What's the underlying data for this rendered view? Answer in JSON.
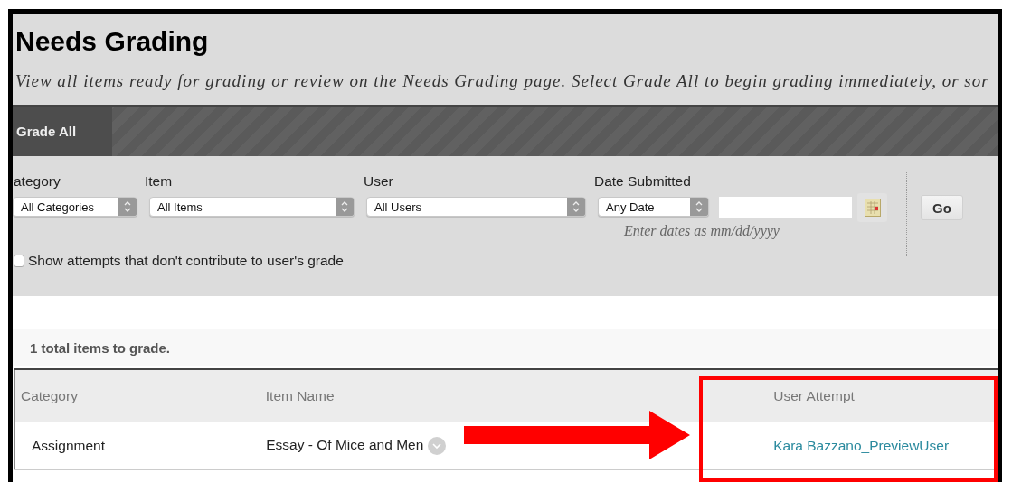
{
  "page": {
    "title": "Needs Grading",
    "description": "View all items ready for grading or review on the Needs Grading page. Select Grade All to begin grading immediately, or sor"
  },
  "action_bar": {
    "buttons": [
      "Grade All"
    ]
  },
  "filters": [
    {
      "label": "ategory",
      "value": "All Categories"
    },
    {
      "label": "Item",
      "value": "All Items"
    },
    {
      "label": "User",
      "value": "All Users"
    },
    {
      "label": "Date Submitted",
      "value": "Any Date"
    }
  ],
  "date_hint": "Enter dates as mm/dd/yyyy",
  "go_button": "Go",
  "show_attempts": {
    "label": "Show attempts that don't contribute to user's grade",
    "checked": false
  },
  "summary": "1 total items to grade.",
  "table": {
    "columns": [
      "Category",
      "Item Name",
      "User Attempt"
    ],
    "rows": [
      {
        "category": "Assignment",
        "item_name": "Essay - Of Mice and Men",
        "user_attempt": "Kara Bazzano_PreviewUser"
      }
    ]
  }
}
